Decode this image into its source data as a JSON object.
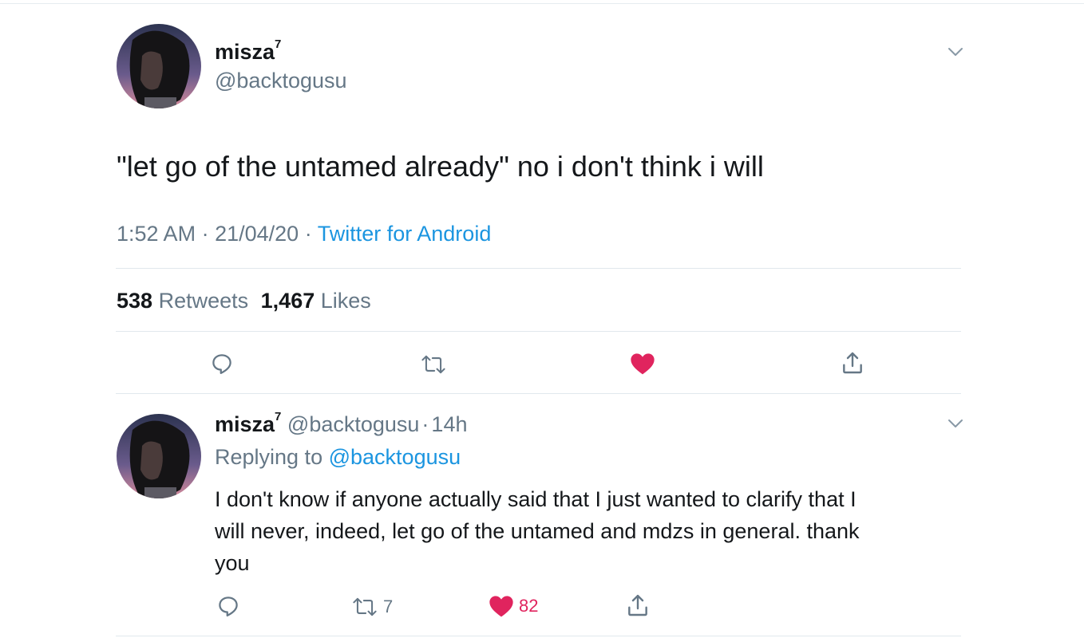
{
  "colors": {
    "text": "#14171a",
    "secondary": "#657786",
    "link": "#1b95e0",
    "like": "#e0245e",
    "divider": "#e1e8ed"
  },
  "main_tweet": {
    "author_name": "misza",
    "author_sup": "7",
    "handle": "@backtogusu",
    "text": "\"let go of the untamed already\" no i don't think i will",
    "time": "1:52 AM",
    "sep1": "·",
    "date": "21/04/20",
    "sep2": "·",
    "source": "Twitter for Android",
    "retweets_count": "538",
    "retweets_label": "Retweets",
    "likes_count": "1,467",
    "likes_label": "Likes",
    "icons": [
      "reply-icon",
      "retweet-icon",
      "like-icon-filled",
      "share-icon"
    ]
  },
  "reply_tweet": {
    "author_name": "misza",
    "author_sup": "7",
    "handle": "@backtogusu",
    "sep": "·",
    "age": "14h",
    "replying_label": "Replying to",
    "replying_handle": "@backtogusu",
    "text_line1": "I don't know if anyone actually said that I just wanted to clarify that I",
    "text_line2": "will never, indeed, let go of the untamed and mdzs in general. thank",
    "text_line3": "you",
    "retweet_count": "7",
    "like_count": "82"
  }
}
